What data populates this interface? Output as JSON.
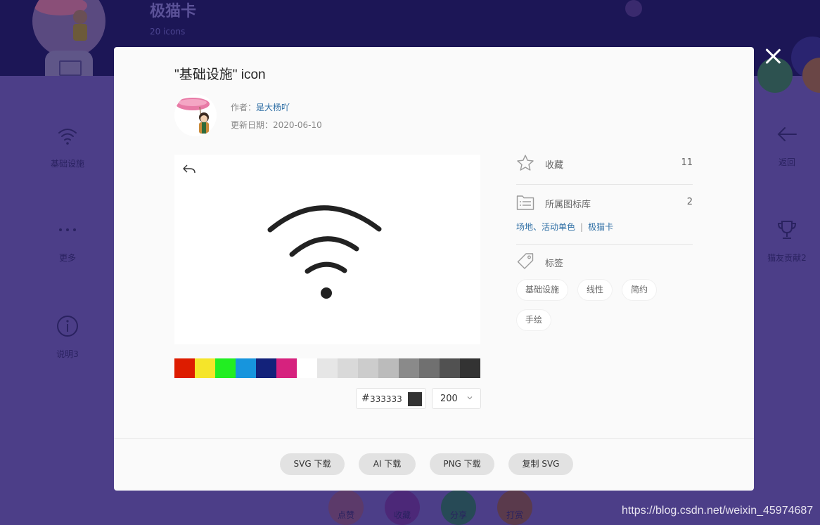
{
  "background": {
    "library_title": "极猫卡",
    "library_subtitle": "20 icons",
    "left_menu": [
      {
        "label": "基础设施",
        "icon": "wifi-icon"
      },
      {
        "label": "更多",
        "icon": "more-dots-icon"
      },
      {
        "label": "说明3",
        "icon": "info-icon"
      }
    ],
    "right_menu": [
      {
        "label": "返回",
        "icon": "back-arrow-icon"
      },
      {
        "label": "猫友贡献2",
        "icon": "trophy-icon"
      }
    ],
    "bottom_actions": [
      "点赞",
      "收藏",
      "分享",
      "打赏"
    ],
    "watermark": "https://blog.csdn.net/weixin_45974687"
  },
  "modal": {
    "title": "\"基础设施\" icon",
    "author_label": "作者：",
    "author_name": "是大杨吖",
    "date_label": "更新日期：",
    "date_value": "2020-06-10",
    "icon_name": "wifi-icon",
    "palette": [
      "#dd1c00",
      "#f5e52a",
      "#22ee22",
      "#1795dd",
      "#13227a",
      "#d6227e",
      "#ffffff",
      "#e6e6e6",
      "#d9d9d9",
      "#cccccc",
      "#bbbbbb",
      "#8a8a8a",
      "#707070",
      "#515151",
      "#333333"
    ],
    "hex_prefix": "#",
    "hex_value": "333333",
    "size_value": "200",
    "favorite": {
      "label": "收藏",
      "count": "11"
    },
    "library": {
      "label": "所属图标库",
      "count": "2",
      "links": [
        "场地、活动单色",
        "极猫卡"
      ],
      "separator": "|"
    },
    "tags_title": "标签",
    "tags": [
      "基础设施",
      "线性",
      "简约",
      "手绘"
    ],
    "buttons": {
      "svg_download": "SVG 下载",
      "ai_download": "AI 下载",
      "png_download": "PNG 下载",
      "copy_svg": "复制 SVG"
    }
  }
}
